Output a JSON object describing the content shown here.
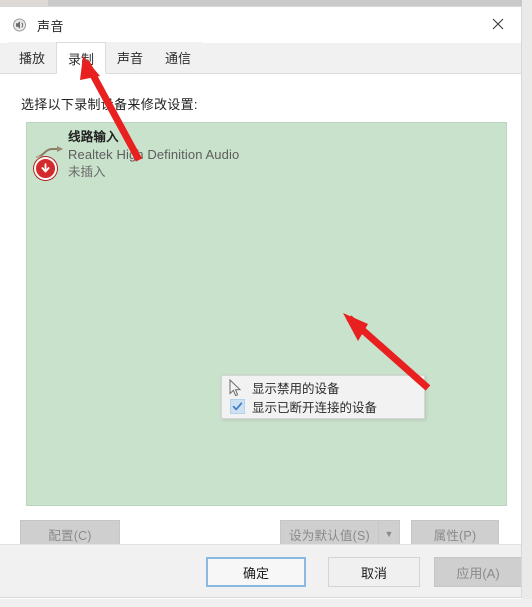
{
  "window": {
    "title": "声音",
    "icon": "speaker-icon",
    "close_label": "✕"
  },
  "tabs": [
    {
      "label": "播放",
      "active": false
    },
    {
      "label": "录制",
      "active": true
    },
    {
      "label": "声音",
      "active": false
    },
    {
      "label": "通信",
      "active": false
    }
  ],
  "main": {
    "hint": "选择以下录制设备来修改设置:",
    "list_background": "#c9e2cc",
    "devices": [
      {
        "name": "线路输入",
        "description": "Realtek High Definition Audio",
        "status": "未插入",
        "icon": "line-in-jack-icon",
        "badge": "unplugged-down-arrow-icon",
        "badge_color": "#d32b2b"
      }
    ]
  },
  "context_menu": {
    "items": [
      {
        "label": "显示禁用的设备",
        "checked": false
      },
      {
        "label": "显示已断开连接的设备",
        "checked": true
      }
    ],
    "check_color": "#3f7fc1"
  },
  "device_buttons": {
    "configure": "配置(C)",
    "set_default": "设为默认值(S)",
    "set_default_arrow": "▼",
    "properties": "属性(P)"
  },
  "footer_buttons": {
    "ok": "确定",
    "cancel": "取消",
    "apply": "应用(A)"
  },
  "annotations": {
    "arrow_color": "#e8201f",
    "arrows": [
      {
        "name": "arrow-to-recording-tab",
        "points_to": "录制"
      },
      {
        "name": "arrow-to-show-disabled-devices",
        "points_to": "显示禁用的设备"
      }
    ]
  }
}
